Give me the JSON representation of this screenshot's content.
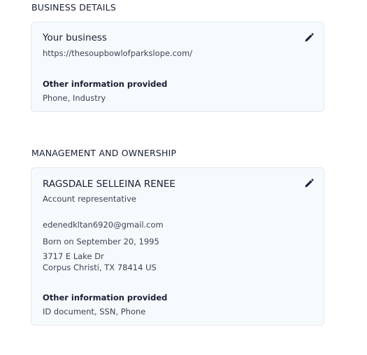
{
  "business_details": {
    "heading": "BUSINESS DETAILS",
    "title": "Your business",
    "url": "https://thesoupbowlofparkslope.com/",
    "other_info_label": "Other information provided",
    "other_info_value": "Phone, Industry",
    "edit_icon": "pencil-icon"
  },
  "management": {
    "heading": "MANAGEMENT AND OWNERSHIP",
    "name": "RAGSDALE SELLEINA RENEE",
    "role": "Account representative",
    "email": "edenedkltan6920@gmail.com",
    "born": "Born on September 20, 1995",
    "address_line1": "3717 E Lake Dr",
    "address_line2": "Corpus Christi, TX 78414 US",
    "other_info_label": "Other information provided",
    "other_info_value": "ID document, SSN, Phone",
    "edit_icon": "pencil-icon"
  },
  "colors": {
    "card_background": "#f7fafc",
    "card_border": "#e3e8ee",
    "text_primary": "#1a1f36",
    "text_secondary": "#3c4257"
  }
}
